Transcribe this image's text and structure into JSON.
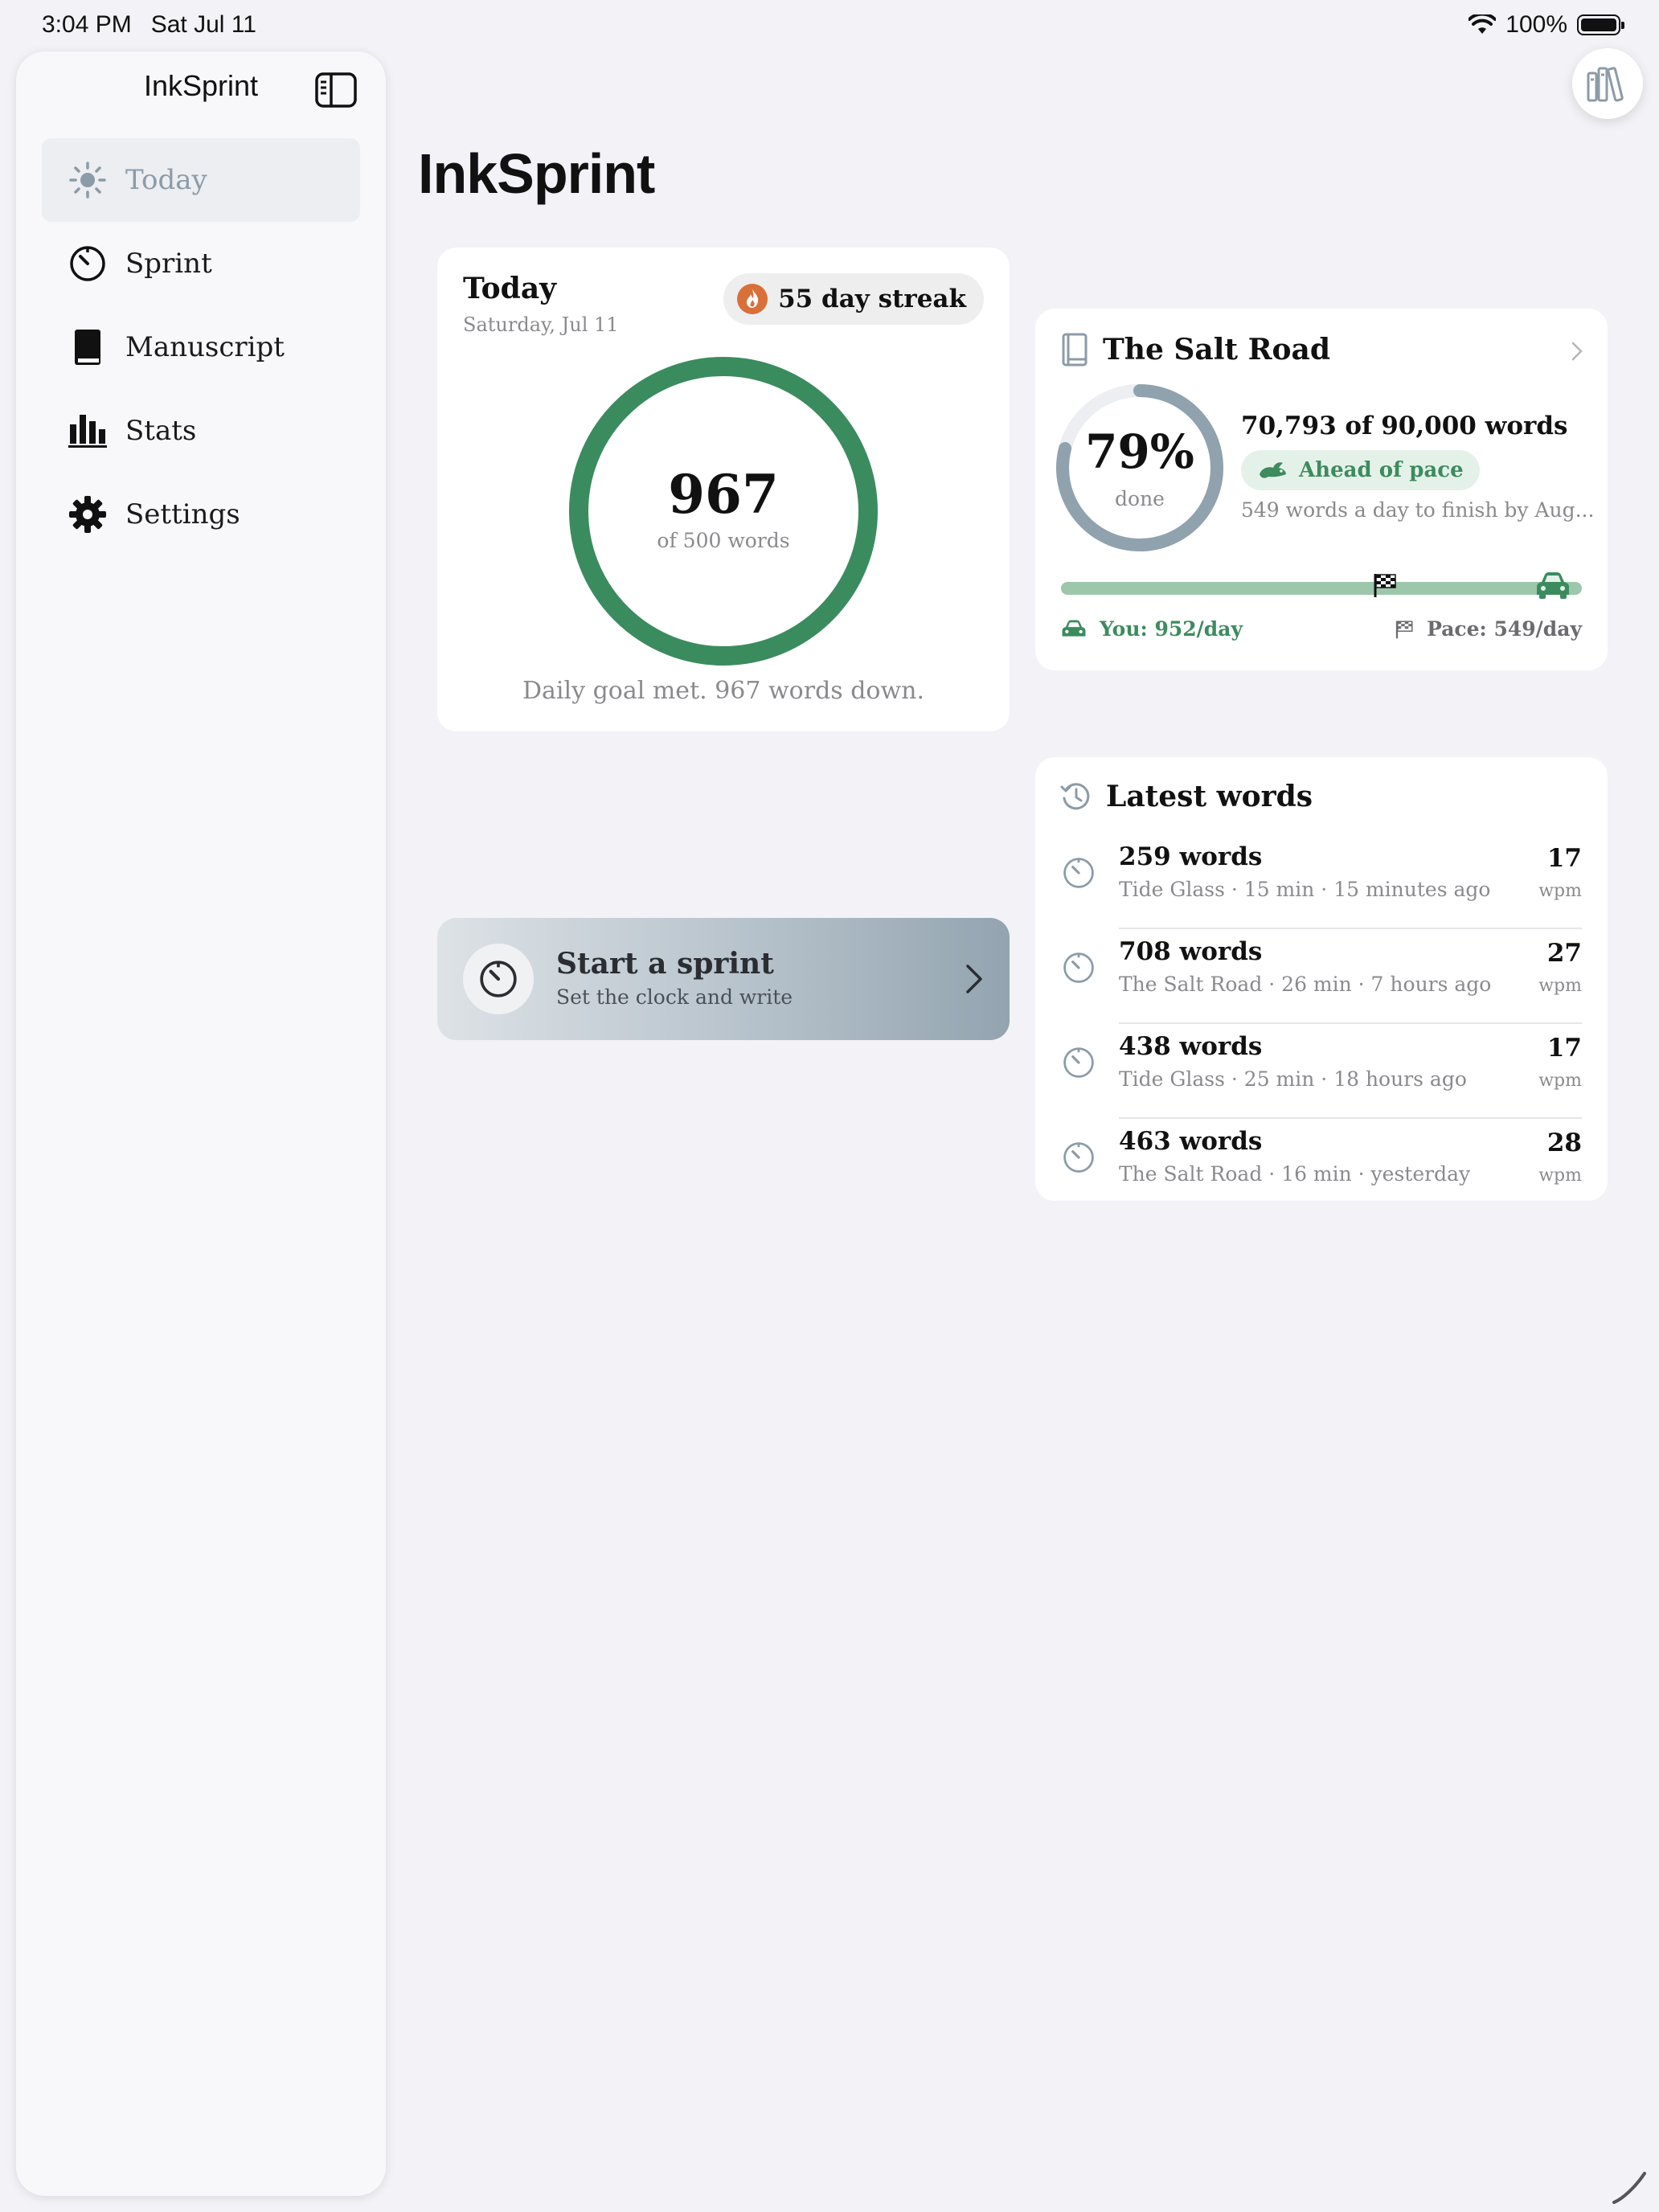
{
  "status_bar": {
    "time": "3:04 PM",
    "date": "Sat Jul 11",
    "battery": "100%"
  },
  "sidebar": {
    "app_name": "InkSprint",
    "items": [
      {
        "label": "Today",
        "icon": "sun-icon",
        "active": true
      },
      {
        "label": "Sprint",
        "icon": "timer-icon",
        "active": false
      },
      {
        "label": "Manuscript",
        "icon": "book-icon",
        "active": false
      },
      {
        "label": "Stats",
        "icon": "bar-chart-icon",
        "active": false
      },
      {
        "label": "Settings",
        "icon": "gear-icon",
        "active": false
      }
    ]
  },
  "page": {
    "title": "InkSprint"
  },
  "today": {
    "label": "Today",
    "date": "Saturday, Jul 11",
    "streak": "55 day streak",
    "words": "967",
    "goal_text": "of 500 words",
    "goal_progress": 1.0,
    "footer": "Daily goal met. 967 words down."
  },
  "sprint": {
    "title": "Start a sprint",
    "subtitle": "Set the clock and write"
  },
  "manuscript": {
    "title": "The Salt Road",
    "percent": "79%",
    "percent_value": 0.79,
    "done_label": "done",
    "words": "70,793 of 90,000 words",
    "pace_badge": "Ahead of pace",
    "pace_text": "549 words a day to finish by Aug...",
    "you_label": "You: 952/day",
    "pace_label": "Pace: 549/day"
  },
  "latest": {
    "title": "Latest words",
    "rows": [
      {
        "words": "259 words",
        "meta": "Tide Glass · 15 min · 15 minutes ago",
        "wpm": "17",
        "unit": "wpm"
      },
      {
        "words": "708 words",
        "meta": "The Salt Road · 26 min · 7 hours ago",
        "wpm": "27",
        "unit": "wpm"
      },
      {
        "words": "438 words",
        "meta": "Tide Glass · 25 min · 18 hours ago",
        "wpm": "17",
        "unit": "wpm"
      },
      {
        "words": "463 words",
        "meta": "The Salt Road · 16 min · yesterday",
        "wpm": "28",
        "unit": "wpm"
      }
    ]
  },
  "colors": {
    "accent_green": "#3a8c5f",
    "slate": "#8fa2ae",
    "streak_orange": "#d9703a"
  }
}
